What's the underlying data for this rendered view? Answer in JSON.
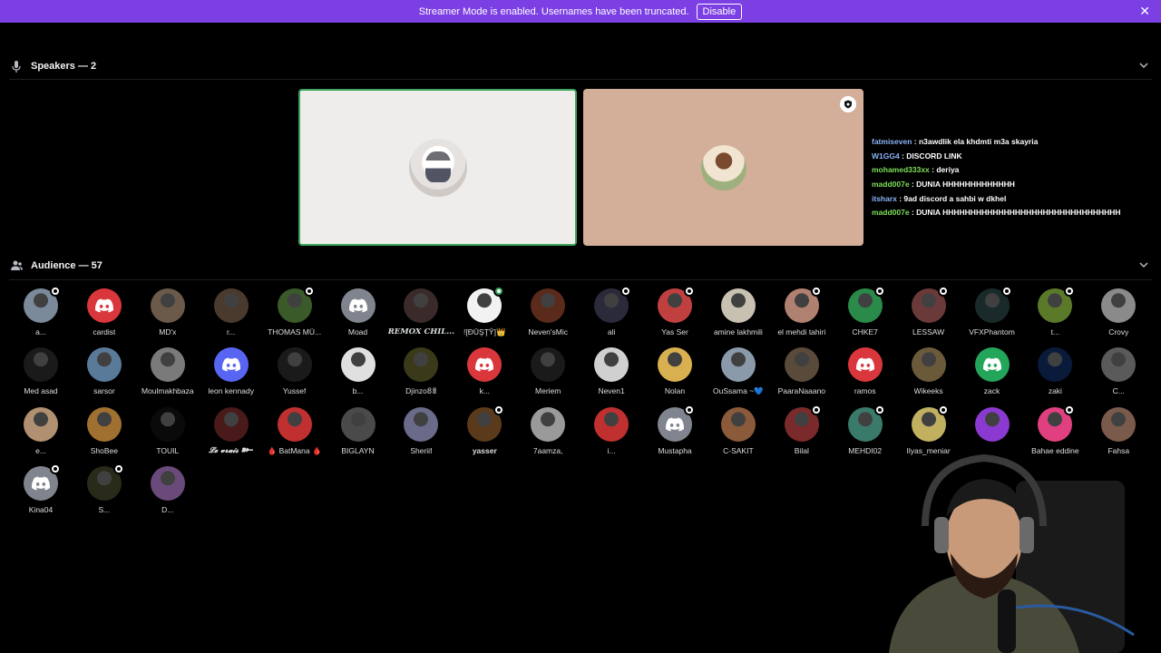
{
  "banner": {
    "message": "Streamer Mode is enabled. Usernames have been truncated.",
    "disable_label": "Disable",
    "color": "#7b3fe4"
  },
  "speakers": {
    "title": "Speakers — 2",
    "icon": "microphone-icon"
  },
  "audience": {
    "title": "Audience — 57",
    "icon": "people-icon"
  },
  "chat": [
    {
      "user": "fatmiseven",
      "color": "#8ab4f8",
      "text": " : n3awdlik ela khdmti m3a skayria"
    },
    {
      "user": "W1GG4",
      "color": "#8ab4f8",
      "text": " : DISCORD LINK"
    },
    {
      "user": "mohamed333xx",
      "color": "#7ee05a",
      "text": " : deriya"
    },
    {
      "user": "madd007e",
      "color": "#7ee05a",
      "text": " : DUNIA HHHHHHHHHHHHH"
    },
    {
      "user": "itsharx",
      "color": "#8ab4f8",
      "text": " : 9ad discord a sahbi w dkhel"
    },
    {
      "user": "madd007e",
      "color": "#7ee05a",
      "text": " : DUNIA HHHHHHHHHHHHHHHHHHHHHHHHHHHHHHHH"
    }
  ],
  "members": [
    {
      "name": "a...",
      "color": "#7a8a9a",
      "badge": "white"
    },
    {
      "name": "cardist",
      "color": "#da373c",
      "discord": true
    },
    {
      "name": "MD'x",
      "color": "#6b5a4a"
    },
    {
      "name": "r...",
      "color": "#4a3a2e"
    },
    {
      "name": "THOMAS MÜ...",
      "color": "#3a5a2a",
      "badge": "white"
    },
    {
      "name": "Moad",
      "color": "#80848e",
      "discord": true
    },
    {
      "name": "REMOX CHIL...",
      "color": "#3a2a2a",
      "style": "serif"
    },
    {
      "name": "![ĐŪŞŢŶ]👑",
      "color": "#f2f2f2",
      "badge": "green"
    },
    {
      "name": "Neven'sMic",
      "color": "#5a2a1a"
    },
    {
      "name": "ali",
      "color": "#2a2a3a",
      "badge": "white"
    },
    {
      "name": "Yas Ser",
      "color": "#c04040",
      "badge": "white"
    },
    {
      "name": "amine lakhmili",
      "color": "#c8c0b0"
    },
    {
      "name": "el mehdi tahiri",
      "color": "#b08070",
      "badge": "white"
    },
    {
      "name": "CHKE7",
      "color": "#2a8a4a",
      "badge": "white"
    },
    {
      "name": "LESSAW",
      "color": "#6a3a3a",
      "badge": "white"
    },
    {
      "name": "VFXPhantom",
      "color": "#1a2a2a",
      "badge": "white"
    },
    {
      "name": "t...",
      "color": "#5a7a2a",
      "badge": "white"
    },
    {
      "name": "Crovy",
      "color": "#8a8a8a"
    },
    {
      "name": "Med asad",
      "color": "#1a1a1a"
    },
    {
      "name": "sarsor",
      "color": "#5a7a9a"
    },
    {
      "name": "Moulmakhbaza",
      "color": "#7a7a7a"
    },
    {
      "name": "leon kennady",
      "color": "#5865f2",
      "discord": true
    },
    {
      "name": "Yussef",
      "color": "#1a1a1a"
    },
    {
      "name": "b...",
      "color": "#e0e0e0"
    },
    {
      "name": "Djinzo𝟠𝟠",
      "color": "#3a3a1a"
    },
    {
      "name": "k...",
      "color": "#da373c",
      "discord": true
    },
    {
      "name": "Meriem",
      "color": "#1a1a1a"
    },
    {
      "name": "Neven1",
      "color": "#d0d0d0"
    },
    {
      "name": "Nolan",
      "color": "#d8b050"
    },
    {
      "name": "OuSsama ~💙",
      "color": "#8a9aaa"
    },
    {
      "name": "PaaraNaaano",
      "color": "#5a4a3a"
    },
    {
      "name": "ramos",
      "color": "#da373c",
      "discord": true
    },
    {
      "name": "Wikeeks",
      "color": "#6a5a3a"
    },
    {
      "name": "zack",
      "color": "#23a55a",
      "discord": true
    },
    {
      "name": "zaki",
      "color": "#0a1a3a"
    },
    {
      "name": "C...",
      "color": "#5a5a5a"
    },
    {
      "name": "e...",
      "color": "#b09070"
    },
    {
      "name": "ShoBee",
      "color": "#a07030"
    },
    {
      "name": "TOUIL",
      "color": "#0a0a0a"
    },
    {
      "name": "𝓛𝓮 𝓿𝓻𝓪𝓲𝓼 ➽━",
      "color": "#4a1a1a",
      "style": "serif"
    },
    {
      "name": "🩸 BatMana 🩸",
      "color": "#c03030"
    },
    {
      "name": "BIGLAYN",
      "color": "#4a4a4a"
    },
    {
      "name": "Sheriif",
      "color": "#6a6a8a"
    },
    {
      "name": "yasser",
      "color": "#5a3a1a",
      "badge": "white",
      "style": "bold"
    },
    {
      "name": "7aamza,",
      "color": "#9a9a9a"
    },
    {
      "name": "i...",
      "color": "#c03030"
    },
    {
      "name": "Mustapha",
      "color": "#80848e",
      "discord": true,
      "badge": "white"
    },
    {
      "name": "C-SAKIT",
      "color": "#8a5a3a"
    },
    {
      "name": "Bilal",
      "color": "#7a2a2a",
      "badge": "white"
    },
    {
      "name": "MEHDI02",
      "color": "#3a7a6a",
      "badge": "white"
    },
    {
      "name": "Ilyas_meniar",
      "color": "#c0b060",
      "badge": "white"
    },
    {
      "name": "",
      "color": "#8a3ad0"
    },
    {
      "name": "Bahae eddine",
      "color": "#e04080",
      "badge": "white"
    },
    {
      "name": "Fahsa",
      "color": "#7a5a4a"
    },
    {
      "name": "Kina04",
      "color": "#80848e",
      "discord": true,
      "badge": "white"
    },
    {
      "name": "S...",
      "color": "#2a2a1a",
      "badge": "white"
    },
    {
      "name": "D...",
      "color": "#6a4a7a"
    }
  ]
}
